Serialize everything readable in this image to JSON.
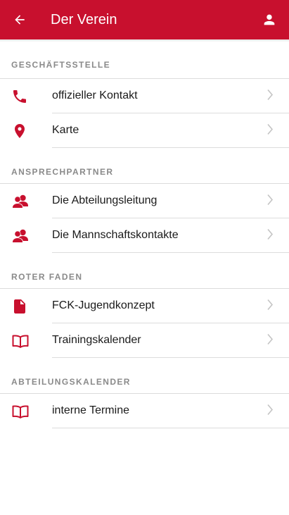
{
  "appbar": {
    "title": "Der Verein",
    "back_icon": "arrow-back-icon",
    "account_icon": "person-icon",
    "color": "#c8102e"
  },
  "sections": [
    {
      "header": "GESCHÄFTSSTELLE",
      "items": [
        {
          "label": "offizieller Kontakt",
          "icon": "phone-icon"
        },
        {
          "label": "Karte",
          "icon": "map-pin-icon"
        }
      ]
    },
    {
      "header": "ANSPRECHPARTNER",
      "items": [
        {
          "label": "Die Abteilungsleitung",
          "icon": "people-icon"
        },
        {
          "label": "Die Mannschaftskontakte",
          "icon": "people-icon"
        }
      ]
    },
    {
      "header": "ROTER FADEN",
      "items": [
        {
          "label": "FCK-Jugendkonzept",
          "icon": "document-icon"
        },
        {
          "label": "Trainingskalender",
          "icon": "book-icon"
        }
      ]
    },
    {
      "header": "ABTEILUNGSKALENDER",
      "items": [
        {
          "label": "interne Termine",
          "icon": "book-icon"
        }
      ]
    }
  ],
  "colors": {
    "accent": "#c8102e",
    "header_text": "#8a8a8a",
    "chevron": "#c4c4c4"
  }
}
